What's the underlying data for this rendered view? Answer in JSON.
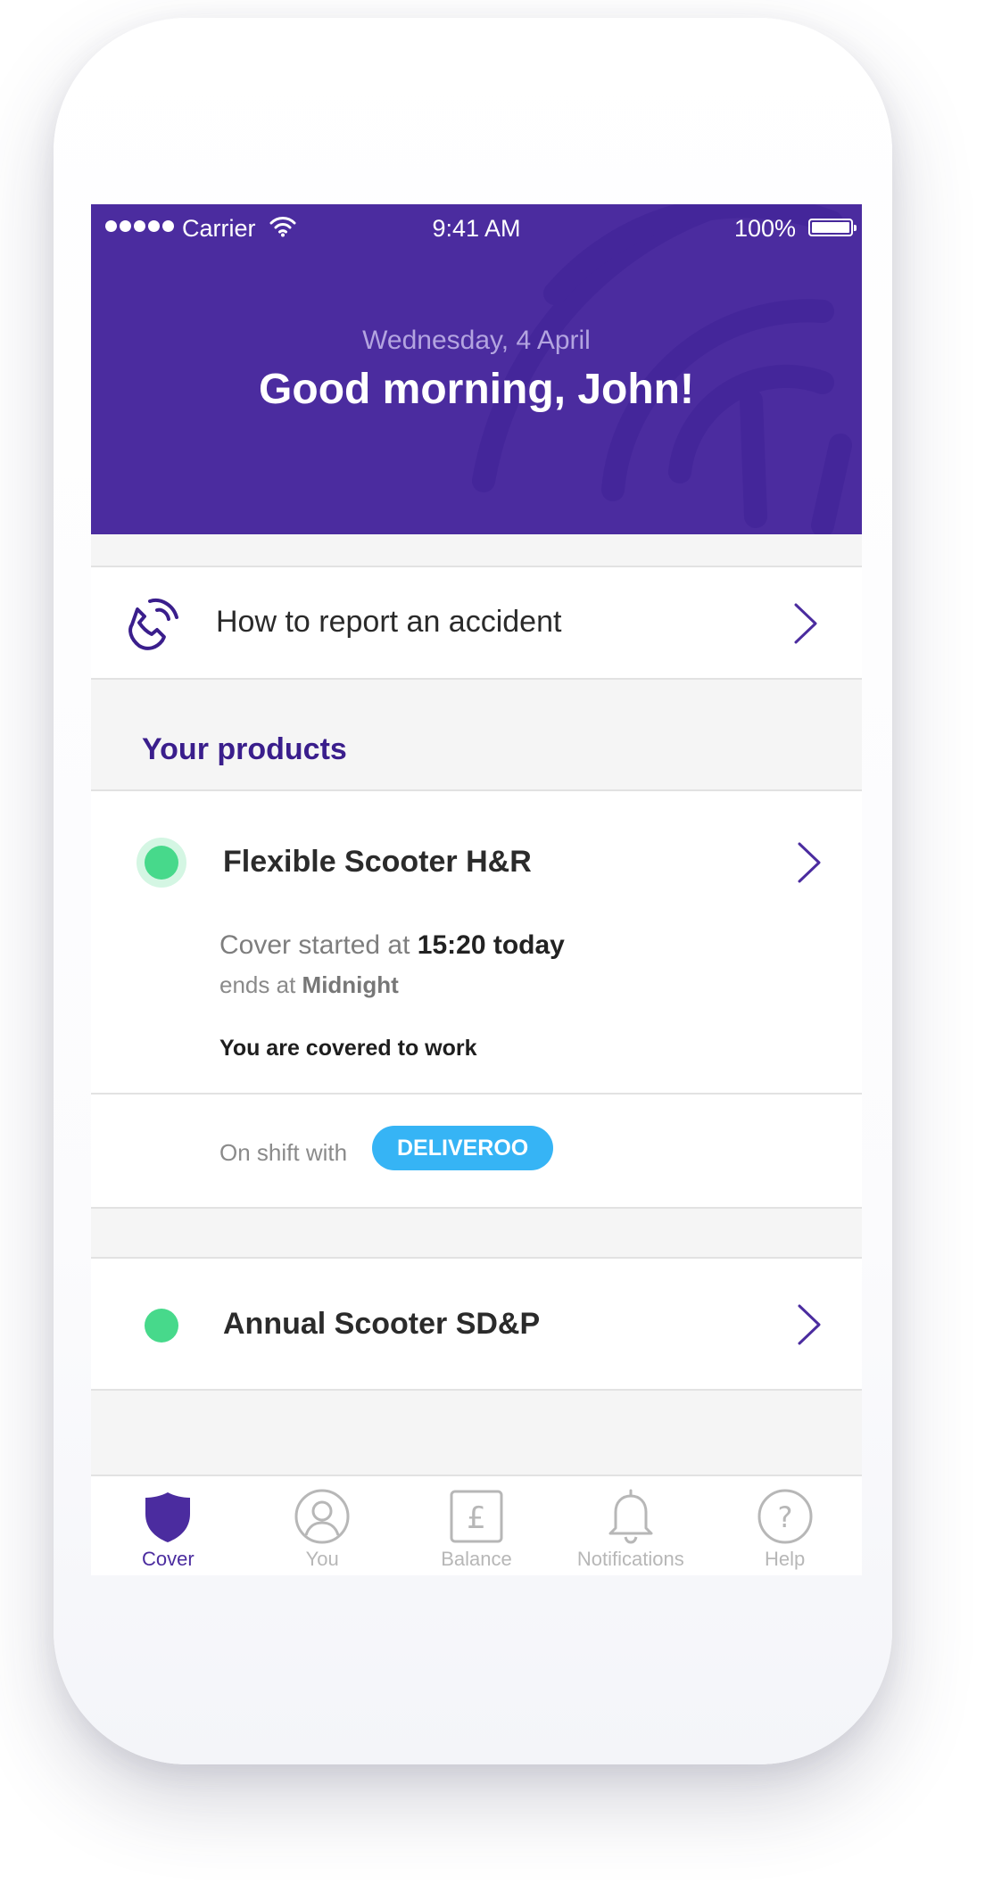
{
  "status_bar": {
    "carrier": "Carrier",
    "time": "9:41 AM",
    "battery": "100%"
  },
  "header": {
    "date": "Wednesday, 4 April",
    "greeting": "Good morning, John!"
  },
  "report_accident": {
    "label": "How to report an accident",
    "icon": "phone-icon"
  },
  "products_section": {
    "title": "Your products"
  },
  "products": [
    {
      "name": "Flexible Scooter H&R",
      "cover_prefix": "Cover started at",
      "cover_time": "15:20 today",
      "ends_prefix": "ends at",
      "ends_time": "Midnight",
      "covered_note": "You are covered to work",
      "shift_text": "On shift with",
      "shift_partner": "DELIVEROO"
    },
    {
      "name": "Annual Scooter SD&P"
    }
  ],
  "tabs": [
    {
      "label": "Cover",
      "icon": "shield-icon",
      "active": true
    },
    {
      "label": "You",
      "icon": "user-icon",
      "active": false
    },
    {
      "label": "Balance",
      "icon": "pound-icon",
      "active": false
    },
    {
      "label": "Notifications",
      "icon": "bell-icon",
      "active": false
    },
    {
      "label": "Help",
      "icon": "help-icon",
      "active": false
    }
  ],
  "colors": {
    "brand_purple": "#4b2c9f",
    "active_green": "#47d98b",
    "deliveroo_blue": "#36b4f5"
  }
}
